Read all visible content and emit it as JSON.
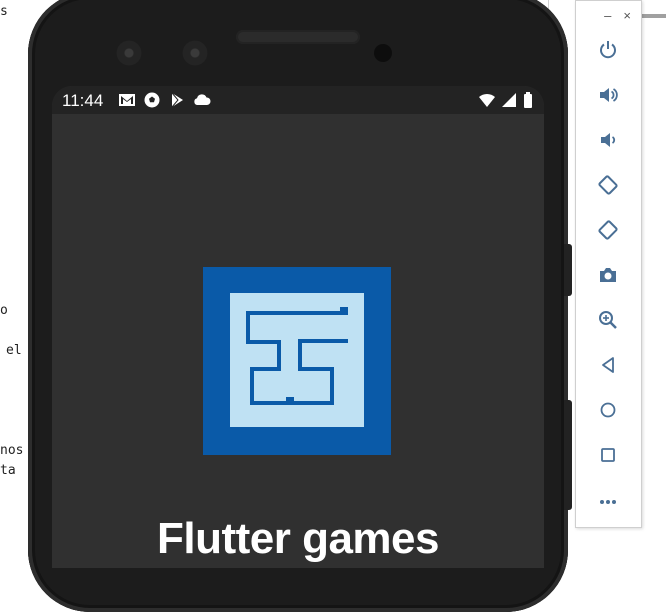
{
  "editor_fragments": [
    "s",
    "o",
    "el",
    "nos",
    "ta"
  ],
  "status_bar": {
    "time": "11:44",
    "left_icons": [
      "gmail-icon",
      "soccer-ball-icon",
      "play-store-icon",
      "cloud-icon"
    ],
    "right_icons": [
      "wifi-icon",
      "cell-signal-icon",
      "battery-icon"
    ]
  },
  "app": {
    "title": "Flutter games",
    "logo_colors": {
      "outer": "#0a5aa8",
      "inner": "#bfe1f3",
      "maze": "#0a5aa8"
    }
  },
  "emulator_toolbar": {
    "window_controls": {
      "minimize": "–",
      "close": "×"
    },
    "buttons": [
      "power-icon",
      "volume-up-icon",
      "volume-down-icon",
      "rotate-left-icon",
      "rotate-right-icon",
      "camera-icon",
      "zoom-icon",
      "back-icon",
      "home-icon",
      "overview-icon",
      "more-icon"
    ],
    "accent": "#4a6f95"
  }
}
